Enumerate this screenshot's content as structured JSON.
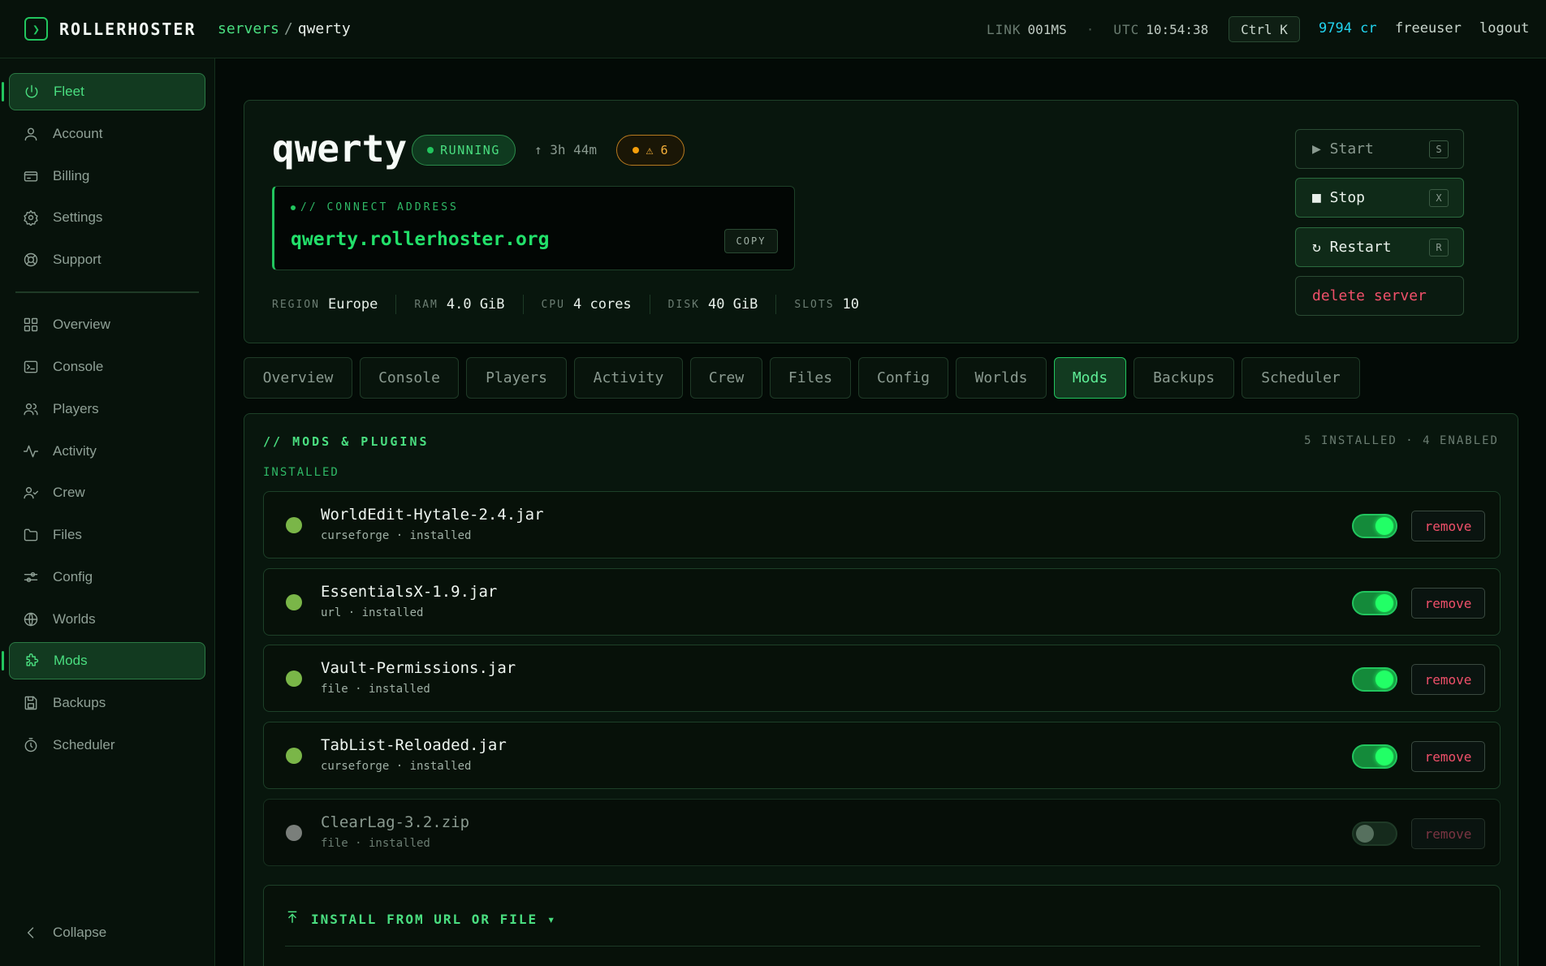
{
  "topbar": {
    "logo_glyph": "❯",
    "brand": "ROLLERHOSTER",
    "crumb_root": "servers",
    "crumb_sep": "/",
    "crumb_current": "qwerty",
    "link_label": "LINK",
    "link_value": "001MS",
    "dot": "·",
    "utc_label": "UTC",
    "utc_value": "10:54:38",
    "shortcut": "Ctrl K",
    "credits": "9794 cr",
    "username": "freeuser",
    "logout": "logout"
  },
  "sidebar": {
    "items": [
      {
        "label": "Fleet",
        "icon": "power-icon"
      },
      {
        "label": "Account",
        "icon": "user-icon"
      },
      {
        "label": "Billing",
        "icon": "credit-card-icon"
      },
      {
        "label": "Settings",
        "icon": "gear-icon"
      },
      {
        "label": "Support",
        "icon": "lifebuoy-icon"
      },
      {
        "label": "Overview",
        "icon": "grid-icon"
      },
      {
        "label": "Console",
        "icon": "terminal-icon"
      },
      {
        "label": "Players",
        "icon": "users-icon"
      },
      {
        "label": "Activity",
        "icon": "activity-icon"
      },
      {
        "label": "Crew",
        "icon": "user-check-icon"
      },
      {
        "label": "Files",
        "icon": "folder-icon"
      },
      {
        "label": "Config",
        "icon": "sliders-icon"
      },
      {
        "label": "Worlds",
        "icon": "globe-icon"
      },
      {
        "label": "Mods",
        "icon": "puzzle-icon"
      },
      {
        "label": "Backups",
        "icon": "save-icon"
      },
      {
        "label": "Scheduler",
        "icon": "timer-icon"
      }
    ],
    "collapse": "Collapse"
  },
  "server": {
    "name": "qwerty",
    "status": "RUNNING",
    "uptime": "↑ 3h 44m",
    "warnings": "⚠ 6",
    "connect_label": "// CONNECT ADDRESS",
    "address": "qwerty.rollerhoster.org",
    "copy": "COPY",
    "specs": [
      {
        "key": "REGION",
        "value": "Europe"
      },
      {
        "key": "RAM",
        "value": "4.0 GiB"
      },
      {
        "key": "CPU",
        "value": "4 cores"
      },
      {
        "key": "DISK",
        "value": "40 GiB"
      },
      {
        "key": "SLOTS",
        "value": "10"
      }
    ],
    "actions": {
      "start": "▶ Start",
      "start_key": "S",
      "stop": "■ Stop",
      "stop_key": "X",
      "restart": "↻ Restart",
      "restart_key": "R",
      "delete": "delete server"
    }
  },
  "tabs": [
    "Overview",
    "Console",
    "Players",
    "Activity",
    "Crew",
    "Files",
    "Config",
    "Worlds",
    "Mods",
    "Backups",
    "Scheduler"
  ],
  "mods": {
    "title": "// MODS & PLUGINS",
    "count": "5 INSTALLED · 4 ENABLED",
    "installed_label": "INSTALLED",
    "remove": "remove",
    "items": [
      {
        "name": "WorldEdit-Hytale-2.4.jar",
        "meta": "curseforge · installed",
        "enabled": true
      },
      {
        "name": "EssentialsX-1.9.jar",
        "meta": "url · installed",
        "enabled": true
      },
      {
        "name": "Vault-Permissions.jar",
        "meta": "file · installed",
        "enabled": true
      },
      {
        "name": "TabList-Reloaded.jar",
        "meta": "curseforge · installed",
        "enabled": true
      },
      {
        "name": "ClearLag-3.2.zip",
        "meta": "file · installed",
        "enabled": false
      }
    ],
    "install_label": "INSTALL FROM URL OR FILE ▾"
  },
  "colors": {
    "accent": "#22c55e",
    "danger": "#f0506a",
    "credits": "#22d3ee",
    "warning": "#f59e0b",
    "background": "#030a06"
  }
}
